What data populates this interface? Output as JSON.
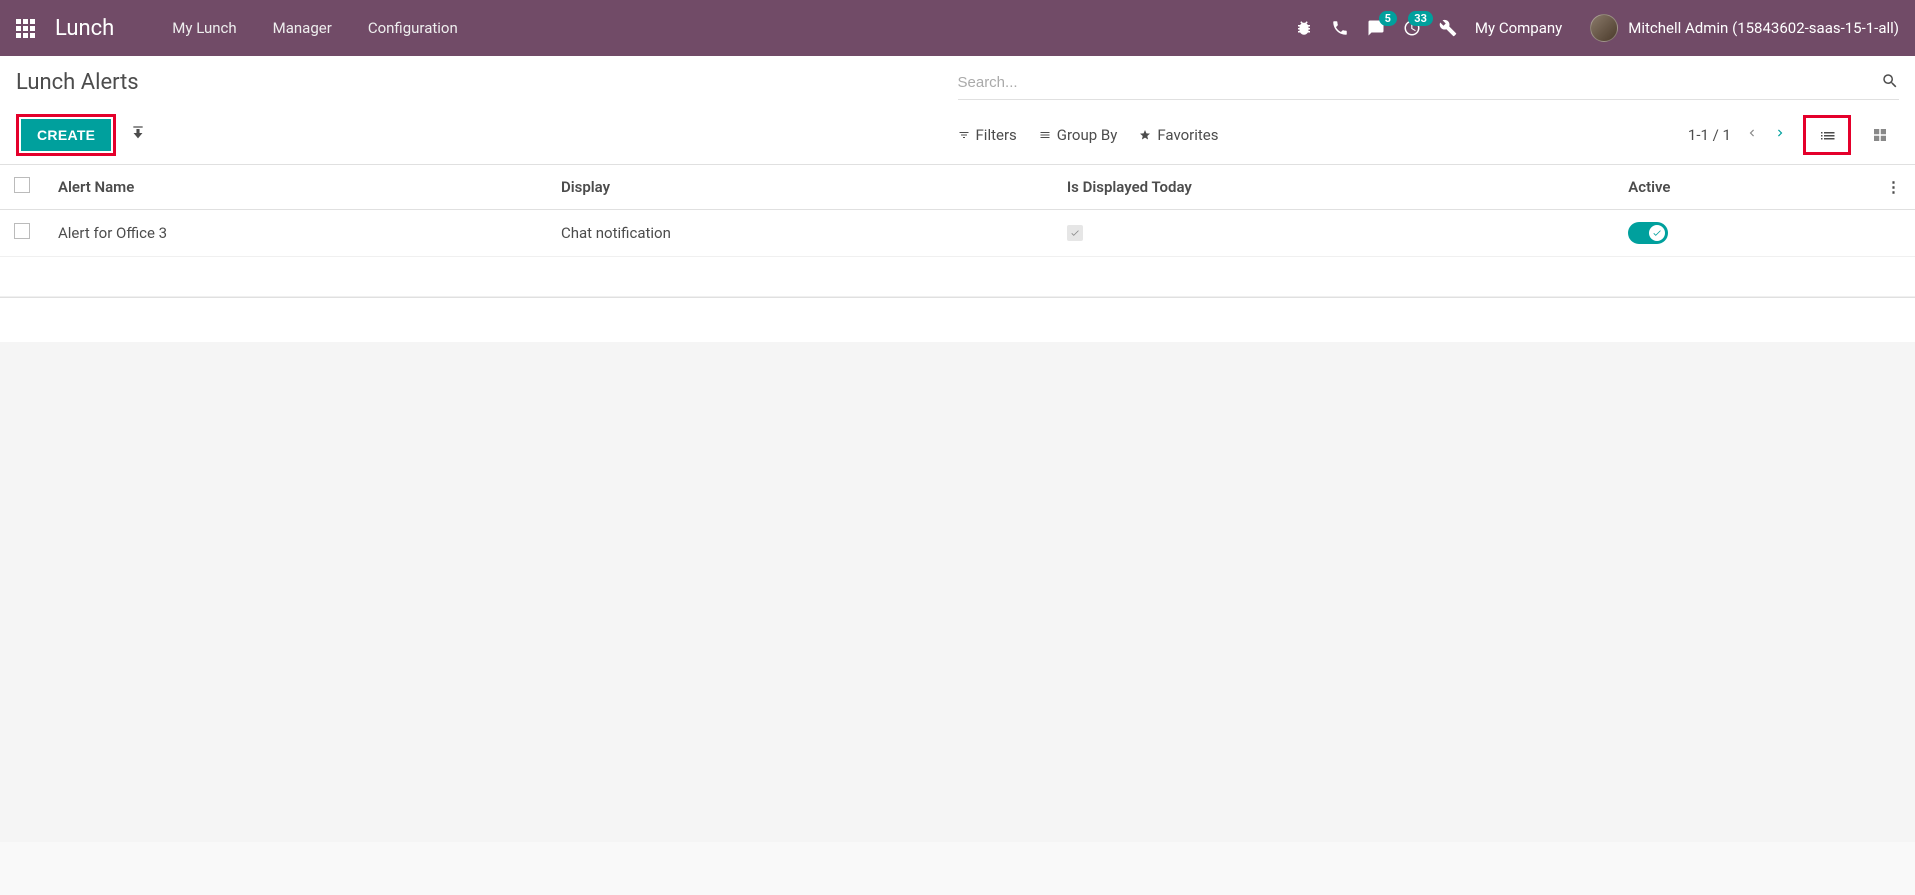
{
  "navbar": {
    "brand": "Lunch",
    "menus": [
      {
        "label": "My Lunch"
      },
      {
        "label": "Manager"
      },
      {
        "label": "Configuration"
      }
    ],
    "message_badge": "5",
    "activity_badge": "33",
    "company": "My Company",
    "user_name": "Mitchell Admin (15843602-saas-15-1-all)"
  },
  "control_panel": {
    "title": "Lunch Alerts",
    "search_placeholder": "Search...",
    "create_label": "CREATE",
    "filters_label": "Filters",
    "groupby_label": "Group By",
    "favorites_label": "Favorites",
    "pager_text": "1-1 / 1"
  },
  "table": {
    "headers": {
      "name": "Alert Name",
      "display": "Display",
      "is_displayed": "Is Displayed Today",
      "active": "Active"
    },
    "rows": [
      {
        "name": "Alert for Office 3",
        "display": "Chat notification",
        "is_displayed_today": true,
        "active": true
      }
    ]
  }
}
